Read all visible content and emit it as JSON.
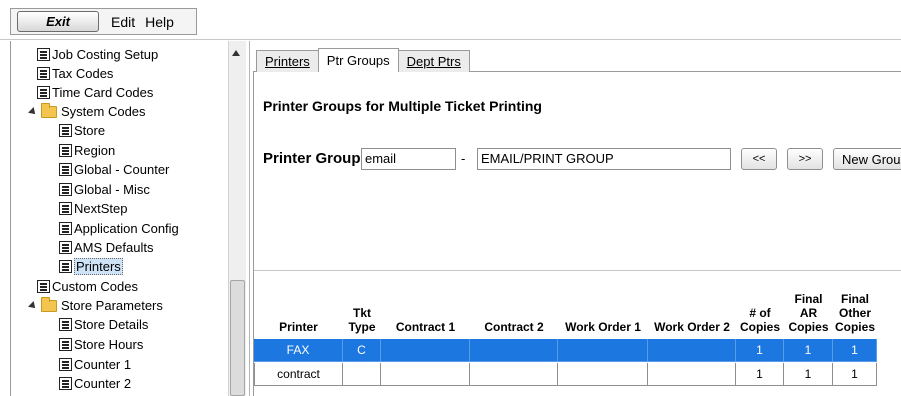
{
  "menubar": {
    "exit_label": "Exit",
    "edit_label": "Edit",
    "help_label": "Help"
  },
  "tree": {
    "items": [
      {
        "label": "Job Costing Setup",
        "type": "doc"
      },
      {
        "label": "Tax Codes",
        "type": "doc"
      },
      {
        "label": "Time Card Codes",
        "type": "doc"
      },
      {
        "label": "System Codes",
        "type": "folder"
      },
      {
        "label": "Store",
        "type": "doc"
      },
      {
        "label": "Region",
        "type": "doc"
      },
      {
        "label": "Global - Counter",
        "type": "doc"
      },
      {
        "label": "Global - Misc",
        "type": "doc"
      },
      {
        "label": "NextStep",
        "type": "doc"
      },
      {
        "label": "Application Config",
        "type": "doc"
      },
      {
        "label": "AMS Defaults",
        "type": "doc"
      },
      {
        "label": "Printers",
        "type": "doc",
        "selected": true
      },
      {
        "label": "Custom Codes",
        "type": "doc"
      },
      {
        "label": "Store Parameters",
        "type": "folder"
      },
      {
        "label": "Store Details",
        "type": "doc"
      },
      {
        "label": "Store Hours",
        "type": "doc"
      },
      {
        "label": "Counter 1",
        "type": "doc"
      },
      {
        "label": "Counter 2",
        "type": "doc"
      }
    ]
  },
  "tabs": [
    {
      "label": "Printers",
      "active": false
    },
    {
      "label": "Ptr Groups",
      "active": true
    },
    {
      "label": "Dept Ptrs",
      "active": false
    }
  ],
  "main": {
    "title": "Printer Groups for Multiple Ticket Printing",
    "printer_group_label": "Printer Group",
    "group_code": "email",
    "dash": "-",
    "group_description": "EMAIL/PRINT GROUP",
    "prev_button": "<<",
    "next_button": ">>",
    "new_group_button": "New Group"
  },
  "grid": {
    "columns": [
      [
        "Printer"
      ],
      [
        "Tkt",
        "Type"
      ],
      [
        "Contract 1"
      ],
      [
        "Contract 2"
      ],
      [
        "Work Order 1"
      ],
      [
        "Work Order 2"
      ],
      [
        "# of",
        "Copies"
      ],
      [
        "Final",
        "AR",
        "Copies"
      ],
      [
        "Final",
        "Other",
        "Copies"
      ]
    ],
    "rows": [
      {
        "cells": [
          "FAX",
          "C",
          "",
          "",
          "",
          "",
          "1",
          "1",
          "1"
        ],
        "selected": true
      },
      {
        "cells": [
          "contract",
          "",
          "",
          "",
          "",
          "",
          "1",
          "1",
          "1"
        ],
        "selected": false
      }
    ]
  },
  "colors": {
    "selection": "#1c78e0",
    "tree_selection": "#cfe3f7"
  }
}
